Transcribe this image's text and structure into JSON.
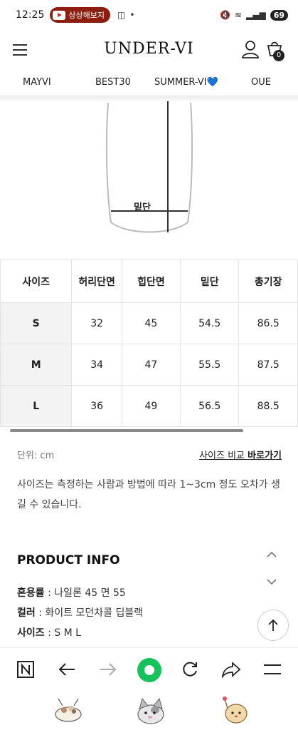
{
  "status": {
    "time": "12:25",
    "pill_label": "상상해보지",
    "battery": "69"
  },
  "header": {
    "logo": "UNDER-VI",
    "cart_count": "0"
  },
  "nav": {
    "items": [
      "MAYVI",
      "BEST30",
      "SUMMER-VI💙",
      "OUE"
    ]
  },
  "diagram": {
    "label": "밑단"
  },
  "size_table": {
    "headers": [
      "사이즈",
      "허리단면",
      "힙단면",
      "밑단",
      "총기장"
    ],
    "rows": [
      {
        "size": "S",
        "waist": "32",
        "hip": "45",
        "hem": "54.5",
        "length": "86.5"
      },
      {
        "size": "M",
        "waist": "34",
        "hip": "47",
        "hem": "55.5",
        "length": "87.5"
      },
      {
        "size": "L",
        "waist": "36",
        "hip": "49",
        "hem": "56.5",
        "length": "88.5"
      }
    ]
  },
  "unit": {
    "label": "단위: cm",
    "compare_prefix": "사이즈 비교 ",
    "compare_bold": "바로가기"
  },
  "notice": "사이즈는 측정하는 사람과 방법에 따라 1~3cm 정도 오차가 생길 수 있습니다.",
  "product_info": {
    "title": "PRODUCT INFO",
    "lines": [
      {
        "key": "혼용률",
        "value": " : 나일론 45 면 55"
      },
      {
        "key": "컬러",
        "value": " : 화이트 모던차콜 딥블랙"
      },
      {
        "key": "사이즈",
        "value": " : S M L"
      }
    ]
  },
  "icons": {
    "toolbar": [
      "naver-n-icon",
      "back-arrow-icon",
      "forward-arrow-icon",
      "green-home-icon",
      "refresh-icon",
      "share-icon",
      "menu-icon"
    ],
    "stickers": [
      "bowl-character-icon",
      "cat-character-icon",
      "hedgehog-character-icon"
    ]
  },
  "colors": {
    "pill": "#8b1e0e",
    "green_button": "#16c35a",
    "size_cell_bg": "#f3f3f3"
  }
}
